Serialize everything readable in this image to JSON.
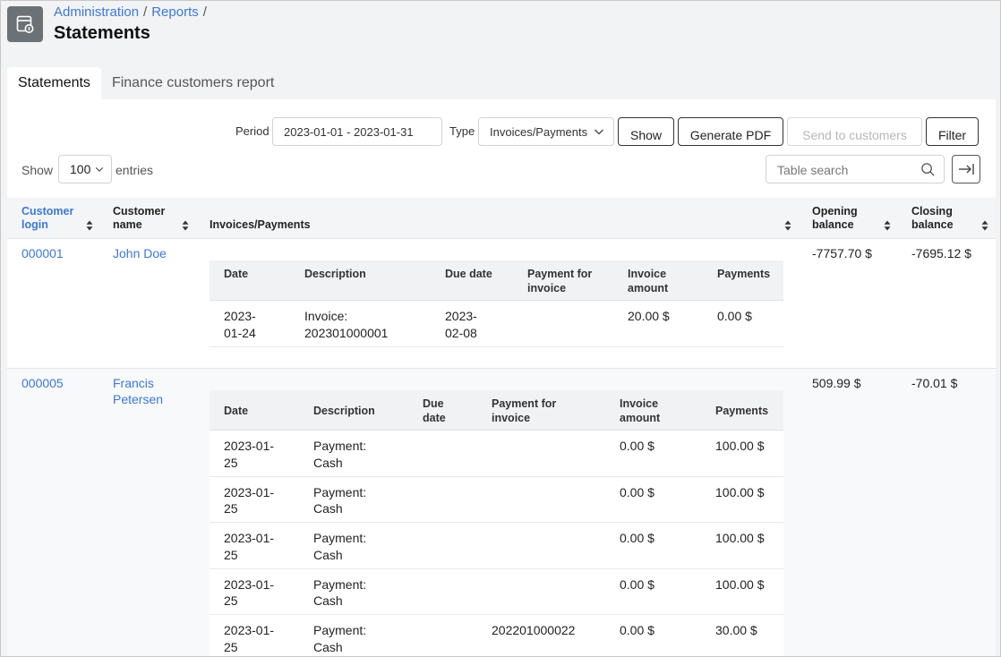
{
  "breadcrumb": [
    "Administration",
    "Reports"
  ],
  "breadcrumb_sep": "/",
  "page_title": "Statements",
  "tabs": [
    {
      "label": "Statements",
      "active": true
    },
    {
      "label": "Finance customers report",
      "active": false
    }
  ],
  "toolbar": {
    "period_label": "Period",
    "period_value": "2023-01-01 - 2023-01-31",
    "type_label": "Type",
    "type_value": "Invoices/Payments",
    "show_label": "Show",
    "pdf_label": "Generate PDF",
    "send_label": "Send to customers",
    "filter_label": "Filter"
  },
  "entries": {
    "prefix": "Show",
    "value": "100",
    "suffix": "entries"
  },
  "search": {
    "placeholder": "Table search"
  },
  "columns": {
    "login": [
      "Customer",
      "login"
    ],
    "name": [
      "Customer",
      "name"
    ],
    "invoices": "Invoices/Payments",
    "opening": [
      "Opening",
      "balance"
    ],
    "closing": [
      "Closing",
      "balance"
    ]
  },
  "sub_columns": {
    "date": "Date",
    "description": "Description",
    "due": [
      "Due",
      "date"
    ],
    "due_single": "Due date",
    "payment_for": [
      "Payment for",
      "invoice"
    ],
    "invoice_amount": [
      "Invoice",
      "amount"
    ],
    "payments": "Payments"
  },
  "customers": [
    {
      "login": "000001",
      "name": [
        "John Doe"
      ],
      "opening": "-7757.70 $",
      "closing": "-7695.12 $",
      "rows": [
        {
          "date": [
            "2023-",
            "01-24"
          ],
          "description": [
            "Invoice:",
            "202301000001"
          ],
          "due": [
            "2023-",
            "02-08"
          ],
          "payment_for": "",
          "invoice_amount": "20.00 $",
          "payments": "0.00 $"
        }
      ]
    },
    {
      "login": "000005",
      "name": [
        "Francis",
        "Petersen"
      ],
      "opening": "509.99 $",
      "closing": "-70.01 $",
      "rows": [
        {
          "date": [
            "2023-01-",
            "25"
          ],
          "description": [
            "Payment:",
            "Cash"
          ],
          "due": [
            "",
            ""
          ],
          "payment_for": "",
          "invoice_amount": "0.00 $",
          "payments": "100.00 $"
        },
        {
          "date": [
            "2023-01-",
            "25"
          ],
          "description": [
            "Payment:",
            "Cash"
          ],
          "due": [
            "",
            ""
          ],
          "payment_for": "",
          "invoice_amount": "0.00 $",
          "payments": "100.00 $"
        },
        {
          "date": [
            "2023-01-",
            "25"
          ],
          "description": [
            "Payment:",
            "Cash"
          ],
          "due": [
            "",
            ""
          ],
          "payment_for": "",
          "invoice_amount": "0.00 $",
          "payments": "100.00 $"
        },
        {
          "date": [
            "2023-01-",
            "25"
          ],
          "description": [
            "Payment:",
            "Cash"
          ],
          "due": [
            "",
            ""
          ],
          "payment_for": "",
          "invoice_amount": "0.00 $",
          "payments": "100.00 $"
        },
        {
          "date": [
            "2023-01-",
            "25"
          ],
          "description": [
            "Payment:",
            "Cash"
          ],
          "due": [
            "",
            ""
          ],
          "payment_for": "202201000022",
          "invoice_amount": "0.00 $",
          "payments": "30.00 $"
        }
      ]
    }
  ],
  "colors": {
    "link": "#3c78d8",
    "icon_bg": "#6c7175"
  }
}
